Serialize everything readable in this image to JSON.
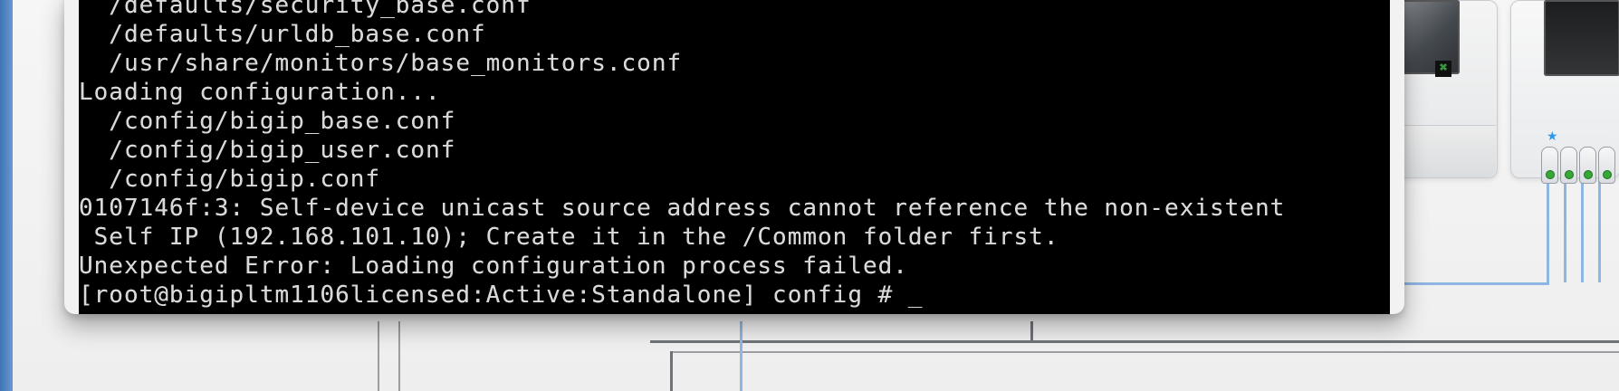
{
  "terminal": {
    "lines": [
      "  /defaults/security_base.conf",
      "  /defaults/urldb_base.conf",
      "  /usr/share/monitors/base_monitors.conf",
      "Loading configuration...",
      "  /config/bigip_base.conf",
      "  /config/bigip_user.conf",
      "  /config/bigip.conf",
      "0107146f:3: Self-device unicast source address cannot reference the non-existent",
      " Self IP (192.168.101.10); Create it in the /Common folder first.",
      "Unexpected Error: Loading configuration process failed.",
      "[root@bigipltm1106licensed:Active:Standalone] config # _"
    ]
  },
  "background": {
    "monitor_indicator": "⌘",
    "port_marker": "★",
    "colors": {
      "terminal_background": "#000000",
      "terminal_text": "#d8d8d8",
      "window_frame": "#f2f2f2",
      "connector_lines": "#6f7276",
      "blue_connectors": "#8fb5e2",
      "port_led": "#35a835",
      "port_star": "#3197e7"
    }
  }
}
